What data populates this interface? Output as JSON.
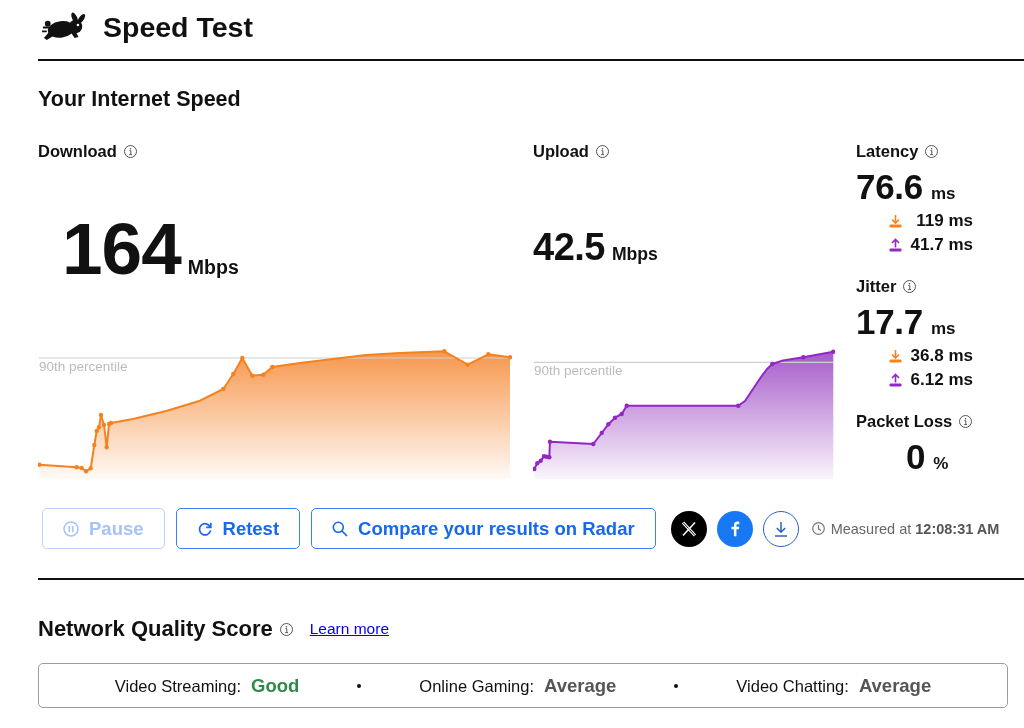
{
  "header": {
    "title": "Speed Test"
  },
  "section_title": "Your Internet Speed",
  "speeds": [
    {
      "kind": "download",
      "label": "Download",
      "value": "164",
      "unit": "Mbps",
      "percentile_label": "90th percentile"
    },
    {
      "kind": "upload",
      "label": "Upload",
      "value": "42.5",
      "unit": "Mbps",
      "percentile_label": "90th percentile"
    }
  ],
  "metrics": [
    {
      "label": "Latency",
      "value": "76.6",
      "unit": "ms",
      "details": [
        {
          "kind": "download",
          "value": "119 ms"
        },
        {
          "kind": "upload",
          "value": "41.7 ms"
        }
      ]
    },
    {
      "label": "Jitter",
      "value": "17.7",
      "unit": "ms",
      "details": [
        {
          "kind": "download",
          "value": "36.8 ms"
        },
        {
          "kind": "upload",
          "value": "6.12 ms"
        }
      ]
    },
    {
      "label": "Packet Loss",
      "value": "0",
      "unit": "%"
    }
  ],
  "actions": [
    {
      "kind": "pause",
      "label": "Pause",
      "disabled": true
    },
    {
      "kind": "retest",
      "label": "Retest",
      "disabled": false
    },
    {
      "kind": "search",
      "label": "Compare your results on Radar",
      "disabled": false
    }
  ],
  "measured_at": "Measured at **12:08:31 AM**",
  "network_quality": {
    "title": "Network Quality Score",
    "link": "Learn more",
    "items": [
      {
        "label": "Video Streaming:",
        "rating": "Good",
        "color": "#2e8b47"
      },
      {
        "label": "Online Gaming:",
        "rating": "Average",
        "color": "#555555"
      },
      {
        "label": "Video Chatting:",
        "rating": "Average",
        "color": "#555555"
      }
    ]
  }
}
